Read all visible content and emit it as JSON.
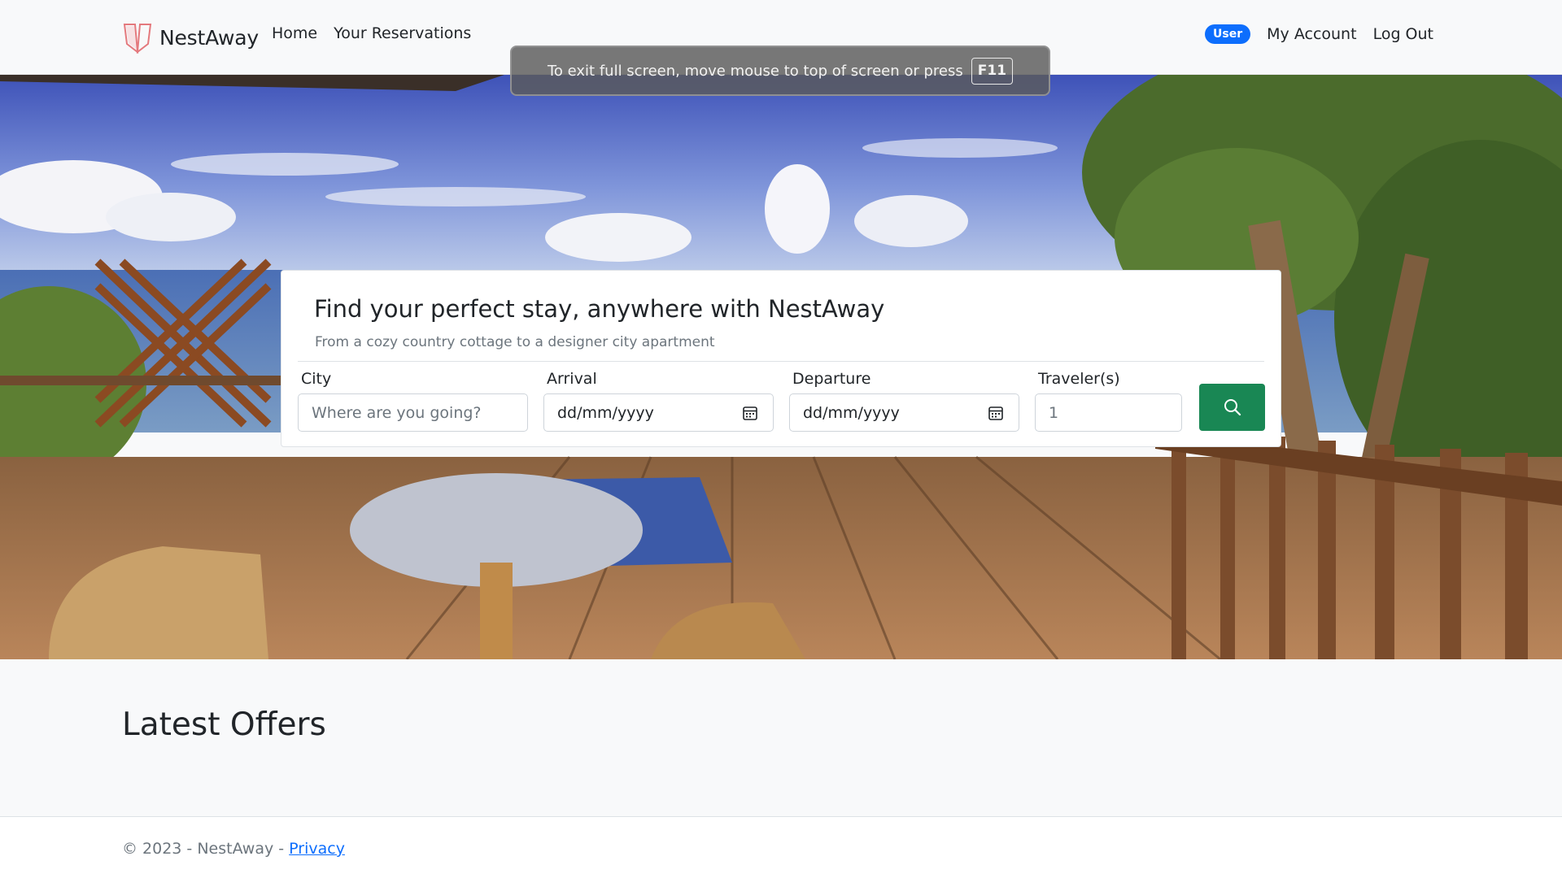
{
  "navbar": {
    "brand": "NestAway",
    "links": [
      "Home",
      "Your Reservations"
    ],
    "role_badge": "User",
    "account_link": "My Account",
    "logout_link": "Log Out"
  },
  "fullscreen_notice": {
    "text": "To exit full screen, move mouse to top of screen or press",
    "key": "F11"
  },
  "search": {
    "title": "Find your perfect stay, anywhere with NestAway",
    "subtitle": "From a cozy country cottage to a designer city apartment",
    "city_label": "City",
    "city_placeholder": "Where are you going?",
    "arrival_label": "Arrival",
    "arrival_placeholder": "dd/mm/yyyy",
    "departure_label": "Departure",
    "departure_placeholder": "dd/mm/yyyy",
    "travelers_label": "Traveler(s)",
    "travelers_value": "1",
    "button_icon": "search-icon"
  },
  "offers": {
    "title": "Latest Offers"
  },
  "footer": {
    "text": "© 2023 - NestAway - ",
    "privacy_link": "Privacy"
  },
  "colors": {
    "primary": "#0d6efd",
    "success": "#198754",
    "brand_logo": "#e4797d"
  }
}
